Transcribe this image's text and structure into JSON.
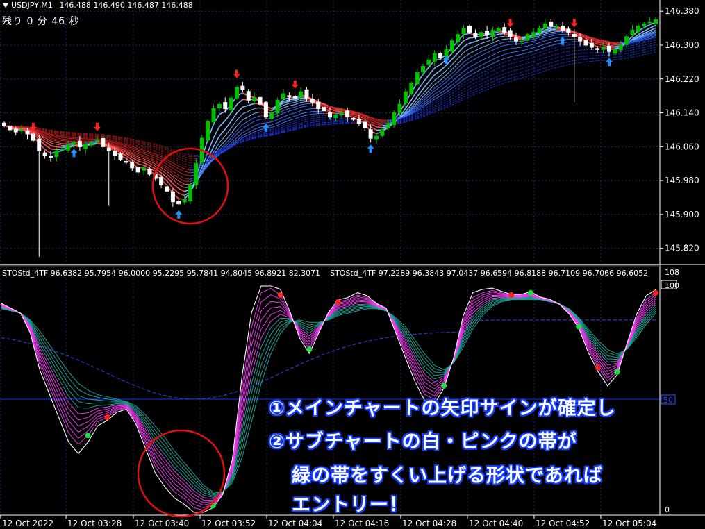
{
  "header": {
    "symbol": "USDJPY,M1",
    "quotes": "146.488 146.490 146.487 146.488",
    "countdown": "残り 0 分 46 秒"
  },
  "price_axis": {
    "labels": [
      "146.380",
      "146.300",
      "146.220",
      "146.140",
      "146.060",
      "145.980",
      "145.900",
      "145.820"
    ],
    "values": [
      146.38,
      146.3,
      146.22,
      146.14,
      146.06,
      145.98,
      145.9,
      145.82
    ]
  },
  "indicator": {
    "header_a": "STOStd_4TF 96.6382 95.7954 96.0000 95.2295 95.7841 94.8045 96.8921 82.3071",
    "header_b": "STOStd_4TF 97.2289 96.3843 97.0437 96.6594 96.8188 96.7109 96.7066 96.6052",
    "axis_labels": [
      "108",
      "100",
      "50",
      "0"
    ],
    "level_50": "50"
  },
  "time_axis": {
    "labels": [
      "12 Oct 2022",
      "12 Oct 03:28",
      "12 Oct 03:40",
      "12 Oct 03:52",
      "12 Oct 04:04",
      "12 Oct 04:16",
      "12 Oct 04:28",
      "12 Oct 04:40",
      "12 Oct 04:52",
      "12 Oct 05:04"
    ]
  },
  "notes": {
    "line1": "①メインチャートの矢印サインが確定し",
    "line2": "②サブチャートの白・ピンクの帯が",
    "line3": "緑の帯をすくい上げる形状であれば",
    "line4": "エントリー！"
  },
  "colors": {
    "bull": "#00c000",
    "bear": "#ffffff",
    "up_arrow": "#1e90ff",
    "down_arrow": "#ff2020",
    "circle": "#e01010",
    "grid": "#1a2a6a",
    "sto_main": "#ff40ff",
    "sto_slow": "#20b0a0"
  },
  "chart_data": {
    "type": "candlestick",
    "symbol": "USDJPY,M1",
    "ylim": [
      145.79,
      146.4
    ],
    "close_path": [
      146.11,
      146.1,
      146.095,
      146.1,
      146.09,
      146.075,
      146.05,
      146.04,
      146.035,
      146.05,
      146.055,
      146.065,
      146.07,
      146.06,
      146.065,
      146.07,
      146.075,
      146.06,
      146.05,
      146.04,
      146.03,
      146.025,
      146.01,
      146.0,
      146.01,
      145.995,
      145.985,
      145.97,
      145.955,
      145.93,
      145.925,
      145.935,
      145.97,
      146.02,
      146.08,
      146.12,
      146.15,
      146.16,
      146.15,
      146.175,
      146.2,
      146.195,
      146.17,
      146.175,
      146.16,
      146.13,
      146.14,
      146.17,
      146.185,
      146.18,
      146.175,
      146.19,
      146.175,
      146.165,
      146.15,
      146.145,
      146.13,
      146.135,
      146.14,
      146.13,
      146.125,
      146.115,
      146.105,
      146.08,
      146.085,
      146.1,
      146.115,
      146.14,
      146.16,
      146.19,
      146.21,
      146.235,
      146.25,
      146.265,
      146.28,
      146.27,
      146.29,
      146.31,
      146.325,
      146.34,
      146.33,
      146.32,
      146.33,
      146.325,
      146.335,
      146.34,
      146.33,
      146.32,
      146.31,
      146.31,
      146.325,
      146.33,
      146.34,
      146.35,
      146.345,
      146.345,
      146.335,
      146.33,
      146.32,
      146.31,
      146.3,
      146.295,
      146.29,
      146.295,
      146.285,
      146.29,
      146.3,
      146.32,
      146.335,
      146.345,
      146.35,
      146.355,
      146.36
    ],
    "up_arrow_bars": [
      12,
      30,
      45,
      63,
      76,
      96,
      104
    ],
    "down_arrow_bars": [
      5,
      16,
      40,
      50,
      87,
      98
    ],
    "subwindow": {
      "name": "STOStd_4TF",
      "ylim": [
        0,
        108
      ],
      "level": 50,
      "main_path": [
        92,
        90,
        88,
        80,
        65,
        55,
        45,
        35,
        30,
        34,
        40,
        42,
        45,
        46,
        40,
        30,
        20,
        14,
        9,
        6,
        2,
        1,
        3,
        8,
        22,
        55,
        82,
        97,
        99,
        96,
        88,
        78,
        72,
        80,
        88,
        93,
        94,
        96,
        95,
        92,
        90,
        80,
        70,
        60,
        52,
        50,
        56,
        68,
        85,
        95,
        97,
        98,
        97,
        96,
        96,
        97,
        95,
        94,
        92,
        88,
        82,
        72,
        64,
        58,
        62,
        74,
        86,
        94,
        97
      ],
      "slow_path": [
        90,
        89,
        88,
        85,
        80,
        74,
        68,
        62,
        57,
        54,
        52,
        51,
        50,
        49,
        47,
        43,
        38,
        33,
        27,
        22,
        17,
        12,
        9,
        9,
        13,
        24,
        40,
        57,
        70,
        79,
        84,
        85,
        84,
        84,
        85,
        87,
        88,
        89,
        90,
        90,
        89,
        86,
        82,
        76,
        70,
        65,
        63,
        66,
        73,
        81,
        87,
        91,
        93,
        94,
        94,
        94,
        94,
        93,
        92,
        90,
        86,
        81,
        76,
        72,
        70,
        72,
        77,
        83,
        88
      ],
      "green_dots": [
        9,
        22,
        32,
        46,
        55,
        60,
        64
      ],
      "red_dots": [
        11,
        29,
        35,
        53,
        62,
        68
      ]
    }
  }
}
